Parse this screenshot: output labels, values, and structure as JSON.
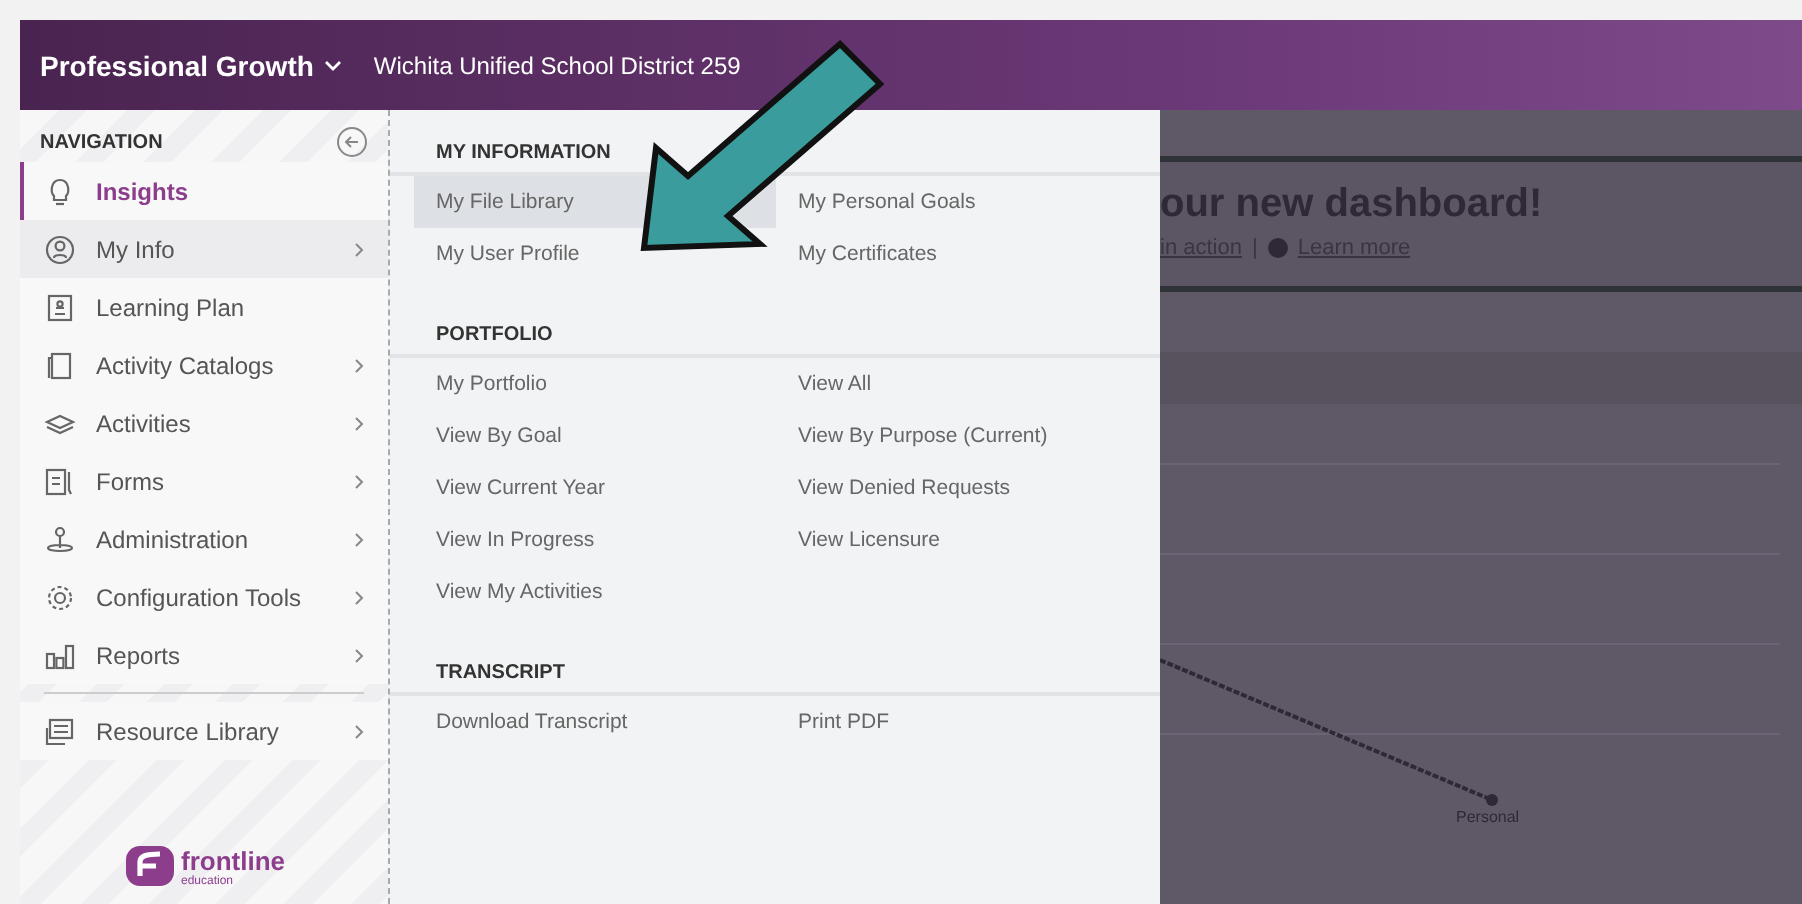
{
  "header": {
    "app_title": "Professional Growth",
    "district": "Wichita Unified School District 259"
  },
  "navigation": {
    "heading": "NAVIGATION",
    "items": [
      {
        "label": "Insights",
        "selected": true,
        "open": false,
        "has_submenu": false
      },
      {
        "label": "My Info",
        "selected": false,
        "open": true,
        "has_submenu": true
      },
      {
        "label": "Learning Plan",
        "selected": false,
        "open": false,
        "has_submenu": false
      },
      {
        "label": "Activity Catalogs",
        "selected": false,
        "open": false,
        "has_submenu": true
      },
      {
        "label": "Activities",
        "selected": false,
        "open": false,
        "has_submenu": true
      },
      {
        "label": "Forms",
        "selected": false,
        "open": false,
        "has_submenu": true
      },
      {
        "label": "Administration",
        "selected": false,
        "open": false,
        "has_submenu": true
      },
      {
        "label": "Configuration Tools",
        "selected": false,
        "open": false,
        "has_submenu": true
      },
      {
        "label": "Reports",
        "selected": false,
        "open": false,
        "has_submenu": true
      },
      {
        "label": "Resource Library",
        "selected": false,
        "open": false,
        "has_submenu": true,
        "divider_before": true
      }
    ],
    "brand": {
      "name": "frontline",
      "tagline": "education"
    }
  },
  "menu": {
    "sections": [
      {
        "heading": "MY INFORMATION",
        "links": [
          {
            "label": "My File Library",
            "selected": true
          },
          {
            "label": "My Personal Goals",
            "selected": false
          },
          {
            "label": "My User Profile",
            "selected": false
          },
          {
            "label": "My Certificates",
            "selected": false
          }
        ]
      },
      {
        "heading": "PORTFOLIO",
        "links": [
          {
            "label": "My Portfolio",
            "selected": false
          },
          {
            "label": "View All",
            "selected": false
          },
          {
            "label": "View By Goal",
            "selected": false
          },
          {
            "label": "View By Purpose (Current)",
            "selected": false
          },
          {
            "label": "View Current Year",
            "selected": false
          },
          {
            "label": "View Denied Requests",
            "selected": false
          },
          {
            "label": "View In Progress",
            "selected": false
          },
          {
            "label": "View Licensure",
            "selected": false
          },
          {
            "label": "View My Activities",
            "selected": false
          }
        ]
      },
      {
        "heading": "TRANSCRIPT",
        "links": [
          {
            "label": "Download Transcript",
            "selected": false
          },
          {
            "label": "Print PDF",
            "selected": false
          }
        ]
      }
    ]
  },
  "dashboard": {
    "banner_title": "our new dashboard!",
    "link_1": "in action",
    "separator": "|",
    "link_2": "Learn more",
    "chart_label": "Personal"
  }
}
